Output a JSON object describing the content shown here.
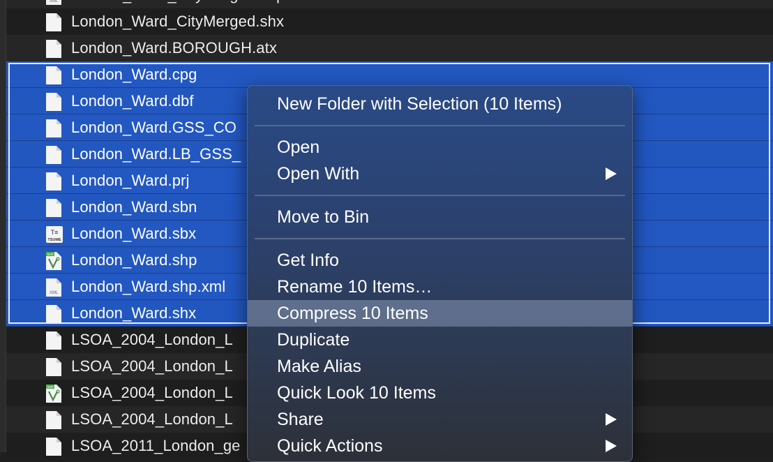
{
  "files": {
    "rows": [
      {
        "name": "London_Ward_CityMerged.shp.xml",
        "icon": "xml-document-icon"
      },
      {
        "name": "London_Ward_CityMerged.shx",
        "icon": "document-icon"
      },
      {
        "name": "London_Ward.BOROUGH.atx",
        "icon": "document-icon"
      },
      {
        "name": "London_Ward.cpg",
        "icon": "document-icon"
      },
      {
        "name": "London_Ward.dbf",
        "icon": "document-icon"
      },
      {
        "name": "London_Ward.GSS_CO",
        "icon": "document-icon"
      },
      {
        "name": "London_Ward.LB_GSS_",
        "icon": "document-icon"
      },
      {
        "name": "London_Ward.prj",
        "icon": "document-icon"
      },
      {
        "name": "London_Ward.sbn",
        "icon": "document-icon"
      },
      {
        "name": "London_Ward.sbx",
        "icon": "tsume-document-icon"
      },
      {
        "name": "London_Ward.shp",
        "icon": "shp-document-icon"
      },
      {
        "name": "London_Ward.shp.xml",
        "icon": "xml-document-icon"
      },
      {
        "name": "London_Ward.shx",
        "icon": "document-icon"
      },
      {
        "name": "LSOA_2004_London_L",
        "icon": "document-icon"
      },
      {
        "name": "LSOA_2004_London_L",
        "icon": "document-icon"
      },
      {
        "name": "LSOA_2004_London_L",
        "icon": "shp-document-icon"
      },
      {
        "name": "LSOA_2004_London_L",
        "icon": "document-icon"
      },
      {
        "name": "LSOA_2011_London_ge",
        "icon": "document-icon"
      }
    ],
    "icon_labels": {
      "xml": "XML",
      "shp": "SHP",
      "tsume_top": "T≡",
      "tsume_bottom": "TSUME"
    }
  },
  "context_menu": {
    "new_folder": "New Folder with Selection (10 Items)",
    "open": "Open",
    "open_with": "Open With",
    "move_to_bin": "Move to Bin",
    "get_info": "Get Info",
    "rename": "Rename 10 Items…",
    "compress": "Compress 10 Items",
    "duplicate": "Duplicate",
    "make_alias": "Make Alias",
    "quick_look": "Quick Look 10 Items",
    "share": "Share",
    "quick_actions": "Quick Actions",
    "highlighted_item": "Compress 10 Items"
  },
  "colors": {
    "selection": "#2358c2",
    "menu_highlight": "#8c9bb8",
    "shp_badge": "#4caf50"
  }
}
